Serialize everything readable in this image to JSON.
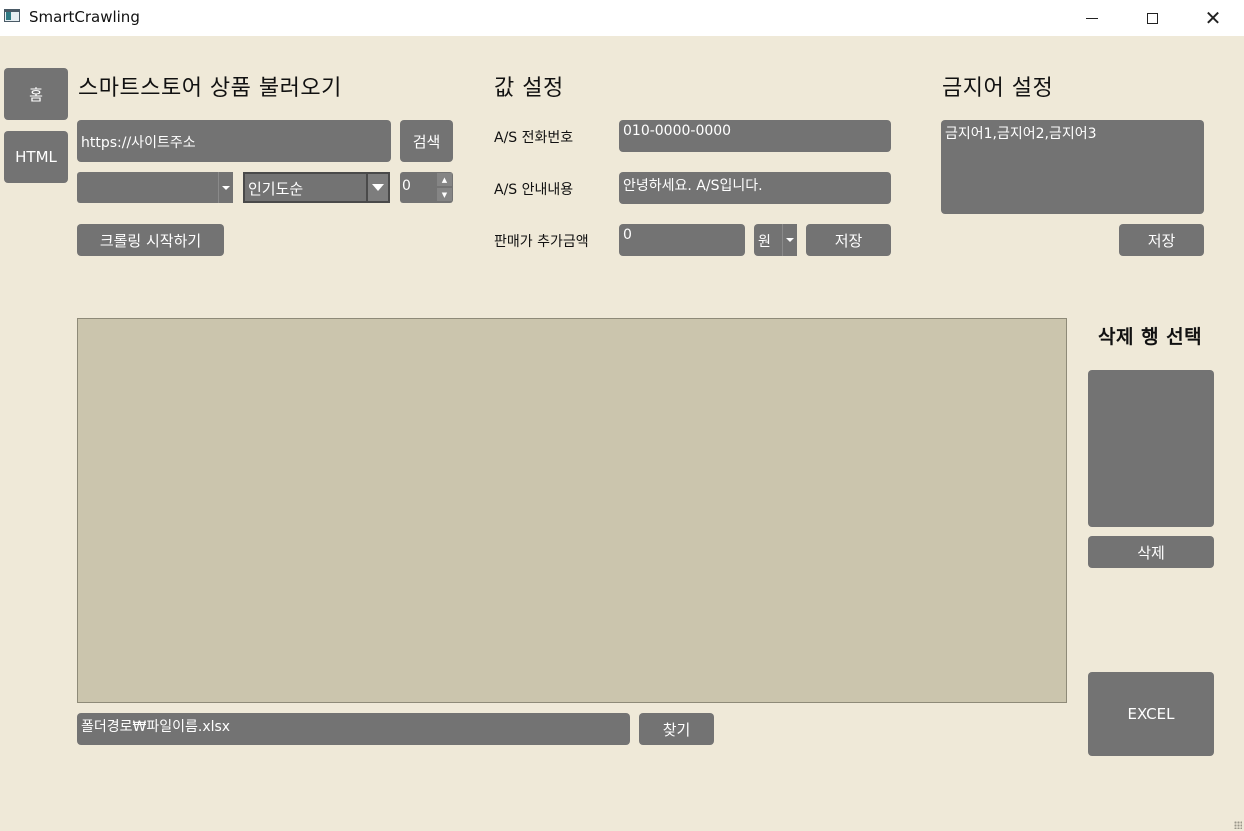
{
  "window": {
    "title": "SmartCrawling"
  },
  "nav": {
    "home_label": "홈",
    "html_label": "HTML"
  },
  "store": {
    "heading": "스마트스토어 상품 불러오기",
    "url_value": "https://사이트주소",
    "search_label": "검색",
    "category_value": "",
    "sort_value": "인기도순",
    "count_value": "0",
    "start_label": "크롤링 시작하기"
  },
  "settings": {
    "heading": "값 설정",
    "as_phone_label": "A/S 전화번호",
    "as_phone_value": "010-0000-0000",
    "as_info_label": "A/S 안내내용",
    "as_info_value": "안녕하세요. A/S입니다.",
    "price_add_label": "판매가 추가금액",
    "price_add_value": "0",
    "unit_value": "원",
    "save_label": "저장"
  },
  "banned": {
    "heading": "금지어 설정",
    "words_value": "금지어1,금지어2,금지어3",
    "save_label": "저장"
  },
  "delete_panel": {
    "heading": "삭제 행 선택",
    "delete_label": "삭제"
  },
  "file": {
    "path_value": "폴더경로₩파일이름.xlsx",
    "find_label": "찾기"
  },
  "excel": {
    "label": "EXCEL"
  }
}
